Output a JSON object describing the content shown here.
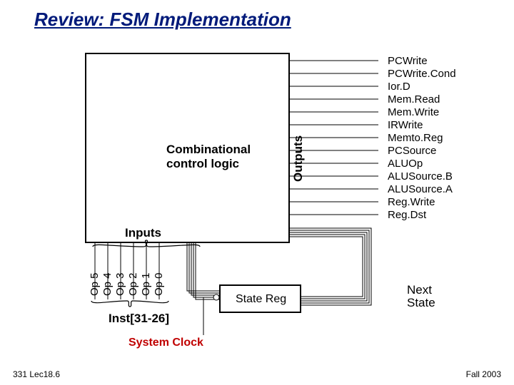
{
  "title": "Review:  FSM Implementation",
  "footer_left": "331 Lec18.6",
  "footer_right": "Fall 2003",
  "combo_label1": "Combinational",
  "combo_label2": "control logic",
  "outputs_label": "Outputs",
  "inputs_label": "Inputs",
  "state_reg_label": "State Reg",
  "inst_label": "Inst[31-26]",
  "system_clock_label": "System Clock",
  "next_label": "Next",
  "state_label": "State",
  "outputs": [
    "PCWrite",
    "PCWrite.Cond",
    "Ior.D",
    "Mem.Read",
    "Mem.Write",
    "IRWrite",
    "Memto.Reg",
    "PCSource",
    "ALUOp",
    "ALUSource.B",
    "ALUSource.A",
    "Reg.Write",
    "Reg.Dst"
  ],
  "ops": [
    "Op 5",
    "Op 4",
    "Op 3",
    "Op 2",
    "Op 1",
    "Op 0"
  ]
}
